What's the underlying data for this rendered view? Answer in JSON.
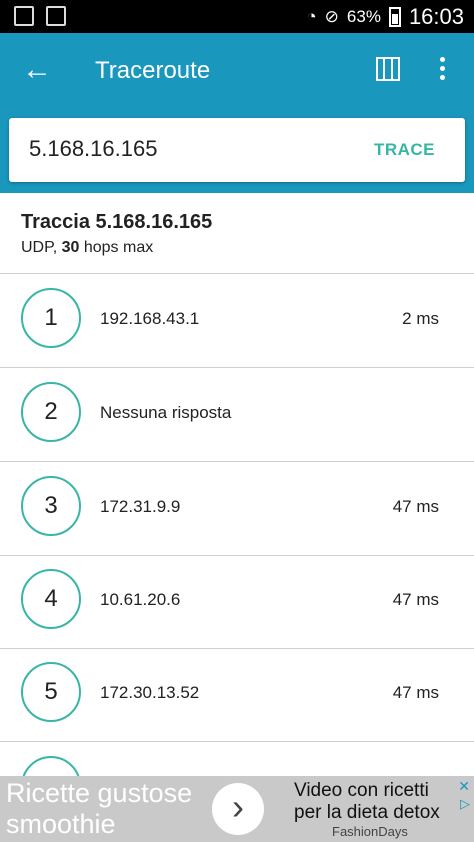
{
  "status_bar": {
    "time": "16:03",
    "battery": "63%"
  },
  "app_bar": {
    "title": "Traceroute"
  },
  "search": {
    "value": "5.168.16.165",
    "button": "TRACE"
  },
  "trace_header": {
    "title": "Traccia 5.168.16.165",
    "protocol": "UDP",
    "hops": "30",
    "hops_suffix": "hops max"
  },
  "hops": [
    {
      "n": "1",
      "host": "192.168.43.1",
      "time": "2 ms"
    },
    {
      "n": "2",
      "host": "Nessuna risposta",
      "time": ""
    },
    {
      "n": "3",
      "host": "172.31.9.9",
      "time": "47 ms"
    },
    {
      "n": "4",
      "host": "10.61.20.6",
      "time": "47 ms"
    },
    {
      "n": "5",
      "host": "172.30.13.52",
      "time": "47 ms"
    }
  ],
  "ad": {
    "left_line1": "Ricette gustose",
    "left_line2": "smoothie",
    "right_line1": "Video con ricetti",
    "right_line2": "per la dieta detox",
    "brand": "FashionDays",
    "close": "✕",
    "arrow": "›"
  }
}
